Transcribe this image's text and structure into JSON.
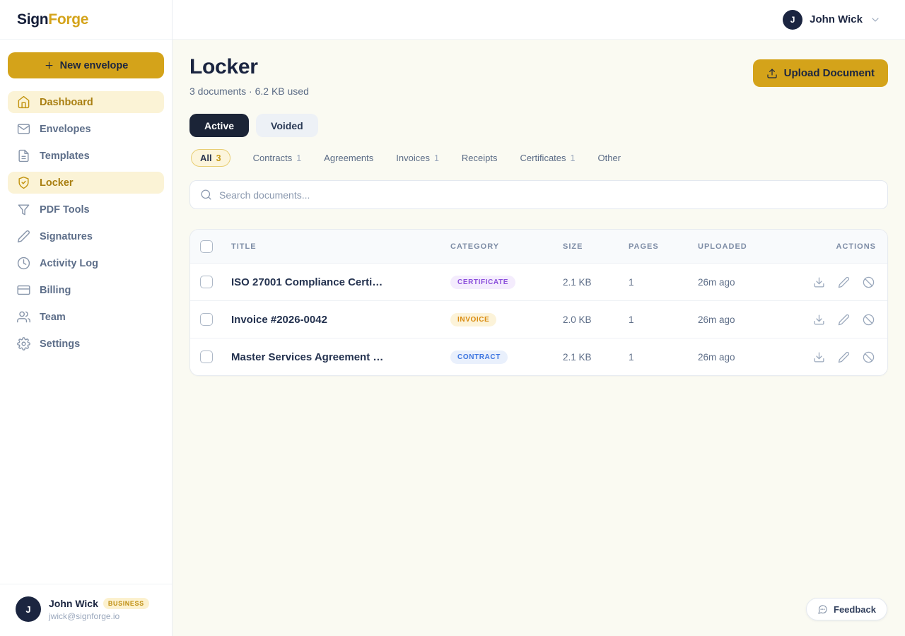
{
  "brand": {
    "name_part1": "Sign",
    "name_part2": "Forge"
  },
  "colors": {
    "accent_gold": "#D4A31A",
    "dark_navy": "#1B2540",
    "active_tab_bg": "#1B2437",
    "sidebar_active_bg": "#FBF3D6",
    "main_bg": "#FAFAF2",
    "badge_certificate": "#8B4FDB",
    "badge_invoice": "#D98A0E",
    "badge_contract": "#3B74E0"
  },
  "sidebar": {
    "new_envelope_label": "New envelope",
    "items": [
      {
        "label": "Dashboard",
        "icon": "home",
        "active": true
      },
      {
        "label": "Envelopes",
        "icon": "envelope",
        "active": false
      },
      {
        "label": "Templates",
        "icon": "document",
        "active": false
      },
      {
        "label": "Locker",
        "icon": "shield-check",
        "active": true
      },
      {
        "label": "PDF Tools",
        "icon": "funnel",
        "active": false
      },
      {
        "label": "Signatures",
        "icon": "pen",
        "active": false
      },
      {
        "label": "Activity Log",
        "icon": "clock",
        "active": false
      },
      {
        "label": "Billing",
        "icon": "credit-card",
        "active": false
      },
      {
        "label": "Team",
        "icon": "users",
        "active": false
      },
      {
        "label": "Settings",
        "icon": "gear",
        "active": false
      }
    ],
    "profile": {
      "initial": "J",
      "name": "John Wick",
      "plan_badge": "BUSINESS",
      "email": "jwick@signforge.io"
    }
  },
  "header": {
    "user_initial": "J",
    "user_name": "John Wick"
  },
  "page": {
    "title": "Locker",
    "subtitle": "3 documents · 6.2 KB used",
    "upload_button_label": "Upload Document",
    "tabs": [
      {
        "label": "Active",
        "selected": true
      },
      {
        "label": "Voided",
        "selected": false
      }
    ],
    "filters": [
      {
        "label": "All",
        "count": "3",
        "selected": true
      },
      {
        "label": "Contracts",
        "count": "1"
      },
      {
        "label": "Agreements",
        "count": ""
      },
      {
        "label": "Invoices",
        "count": "1"
      },
      {
        "label": "Receipts",
        "count": ""
      },
      {
        "label": "Certificates",
        "count": "1"
      },
      {
        "label": "Other",
        "count": ""
      }
    ],
    "search_placeholder": "Search documents..."
  },
  "table": {
    "columns": [
      "TITLE",
      "CATEGORY",
      "SIZE",
      "PAGES",
      "UPLOADED",
      "ACTIONS"
    ],
    "rows": [
      {
        "title": "ISO 27001 Compliance Certi…",
        "category": "CERTIFICATE",
        "category_color": "purple",
        "size": "2.1 KB",
        "pages": "1",
        "uploaded": "26m ago"
      },
      {
        "title": "Invoice #2026-0042",
        "category": "INVOICE",
        "category_color": "amber",
        "size": "2.0 KB",
        "pages": "1",
        "uploaded": "26m ago"
      },
      {
        "title": "Master Services Agreement …",
        "category": "CONTRACT",
        "category_color": "blue",
        "size": "2.1 KB",
        "pages": "1",
        "uploaded": "26m ago"
      }
    ]
  },
  "feedback": {
    "label": "Feedback"
  }
}
